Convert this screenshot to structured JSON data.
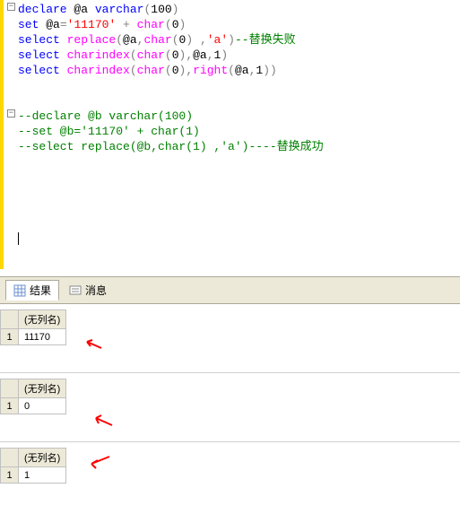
{
  "code": {
    "l1": {
      "kw1": "declare",
      "var": "@a",
      "kw2": "varchar",
      "num": "100"
    },
    "l2": {
      "kw": "set",
      "var": "@a",
      "eq": "=",
      "str": "'11170'",
      "plus": " + ",
      "fn": "char",
      "num": "0"
    },
    "l3": {
      "kw": "select",
      "fn1": "replace",
      "var": "@a",
      "fn2": "char",
      "num": "0",
      "str": "'a'",
      "comment": "--替换失败"
    },
    "l4": {
      "kw": "select",
      "fn1": "charindex",
      "fn2": "char",
      "num1": "0",
      "var": "@a",
      "num2": "1"
    },
    "l5": {
      "kw": "select",
      "fn1": "charindex",
      "fn2": "char",
      "num1": "0",
      "fn3": "right",
      "var": "@a",
      "num2": "1"
    },
    "l8": {
      "comment": "--declare @b varchar(100)"
    },
    "l9": {
      "comment": "--set @b='11170' + char(1)"
    },
    "l10": {
      "comment": "--select replace(@b,char(1) ,'a')----替换成功"
    }
  },
  "tabs": {
    "results": "结果",
    "messages": "消息"
  },
  "grids": {
    "noColName": "(无列名)",
    "g1": {
      "row": "1",
      "val": "11170 "
    },
    "g2": {
      "row": "1",
      "val": "0"
    },
    "g3": {
      "row": "1",
      "val": "1"
    }
  }
}
